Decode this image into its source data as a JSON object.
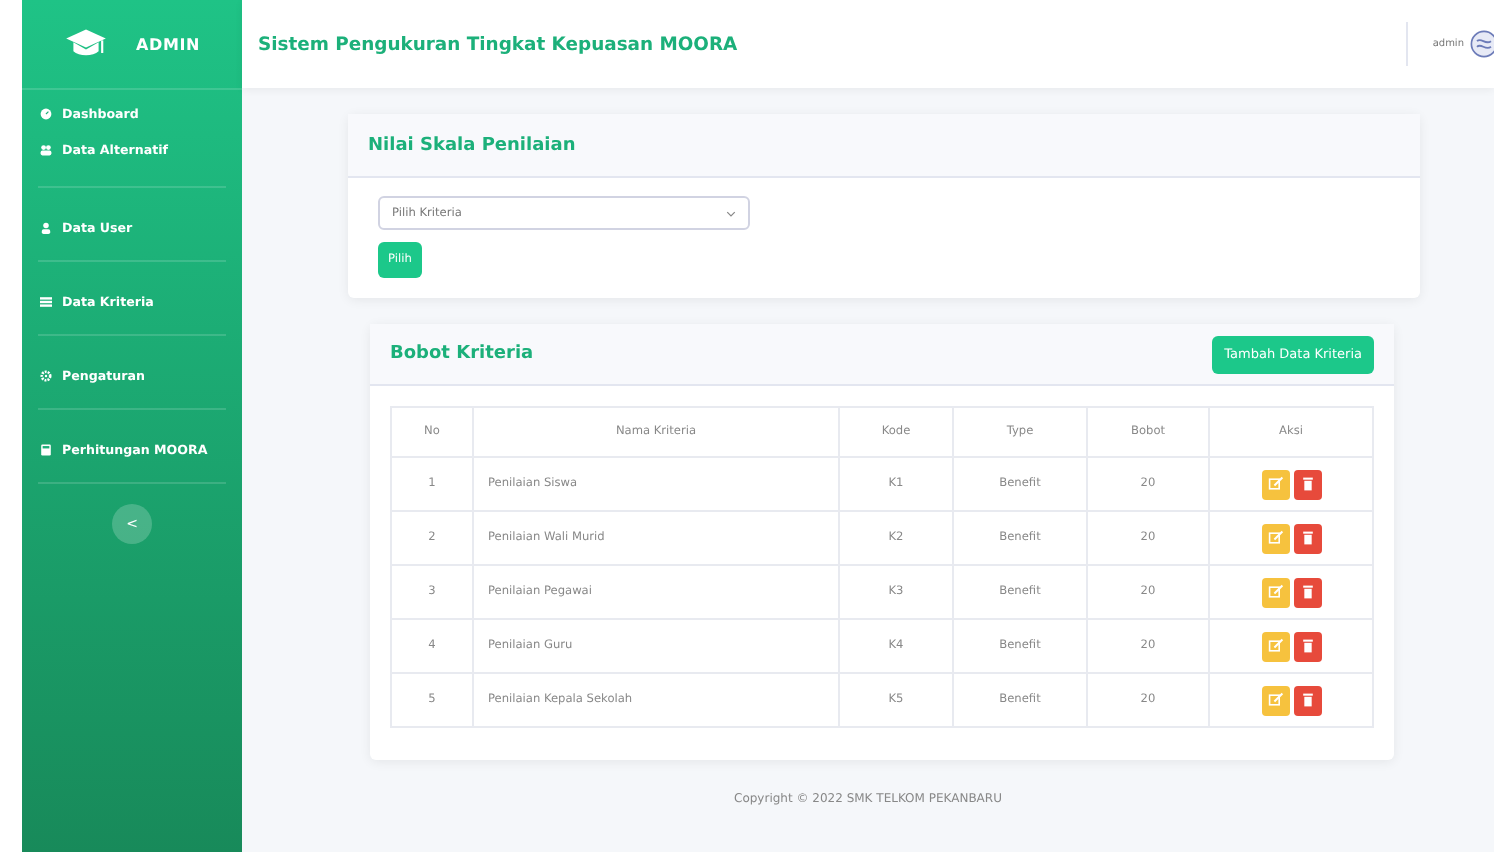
{
  "sidebar": {
    "brand": "ADMIN",
    "items": [
      {
        "label": "Dashboard"
      },
      {
        "label": "Data Alternatif"
      },
      {
        "label": "Data User"
      },
      {
        "label": "Data Kriteria"
      },
      {
        "label": "Pengaturan"
      },
      {
        "label": "Perhitungan MOORA"
      }
    ],
    "toggle": "<"
  },
  "topbar": {
    "title": "Sistem Pengukuran Tingkat Kepuasan MOORA",
    "user": "admin"
  },
  "scale_card": {
    "title": "Nilai Skala Penilaian",
    "select": {
      "value": "Pilih Kriteria"
    },
    "button": "Pilih"
  },
  "weights_card": {
    "title": "Bobot Kriteria",
    "add_button": "Tambah Data Kriteria",
    "table": {
      "columns": [
        "No",
        "Nama Kriteria",
        "Kode",
        "Type",
        "Bobot",
        "Aksi"
      ],
      "rows": [
        {
          "no": "1",
          "name": "Penilaian Siswa",
          "code": "K1",
          "type": "Benefit",
          "weight": "20"
        },
        {
          "no": "2",
          "name": "Penilaian Wali Murid",
          "code": "K2",
          "type": "Benefit",
          "weight": "20"
        },
        {
          "no": "3",
          "name": "Penilaian Pegawai",
          "code": "K3",
          "type": "Benefit",
          "weight": "20"
        },
        {
          "no": "4",
          "name": "Penilaian Guru",
          "code": "K4",
          "type": "Benefit",
          "weight": "20"
        },
        {
          "no": "5",
          "name": "Penilaian Kepala Sekolah",
          "code": "K5",
          "type": "Benefit",
          "weight": "20"
        }
      ]
    }
  },
  "footer": "Copyright © 2022 SMK TELKOM PEKANBARU"
}
